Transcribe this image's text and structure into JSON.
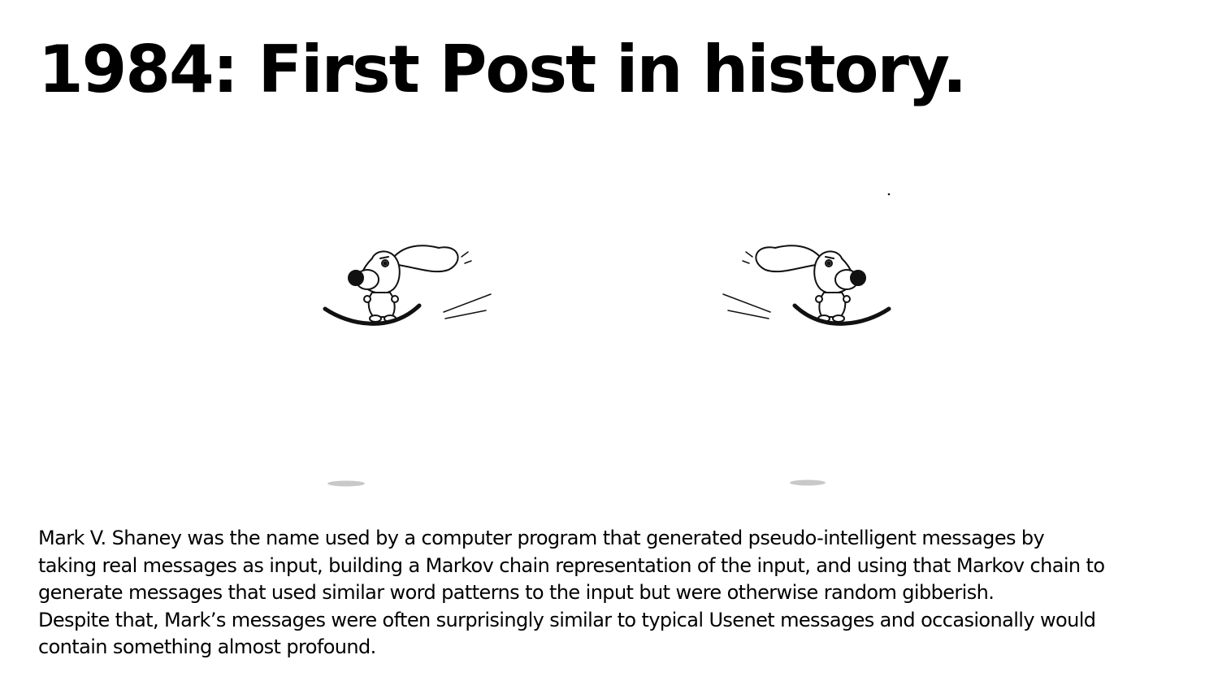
{
  "slide": {
    "title": "1984: First Post in history.",
    "lines": [
      "Mark V. Shaney was the name used by a computer program that generated pseudo-intelligent messages by",
      "taking real messages as input, building a Markov chain representation of the input, and using that Markov chain to",
      "generate messages that used similar word patterns to the input but were otherwise random gibberish.",
      "Despite that, Mark’s messages were often surprisingly similar to typical Usenet messages and occasionally would",
      "contain something almost profound."
    ]
  }
}
